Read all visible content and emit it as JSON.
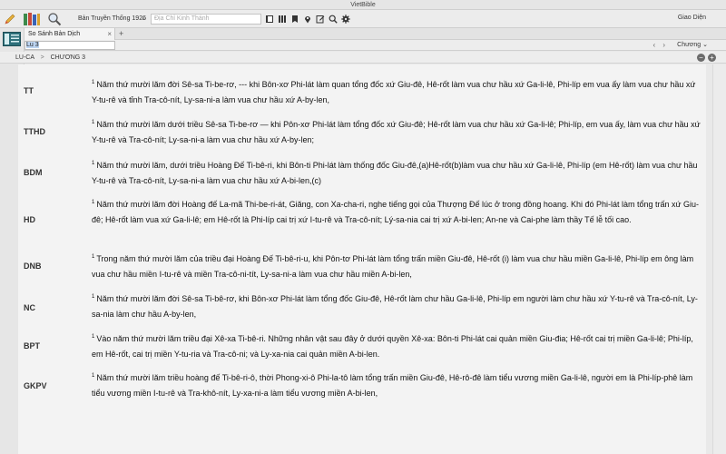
{
  "app": {
    "title": "VietBible"
  },
  "toolbar": {
    "version_select": "Bản Truyền Thống 1926",
    "search_placeholder": "Địa Chỉ Kinh Thánh",
    "theme_label": "Giao Diện"
  },
  "tabs": [
    {
      "label": "So Sánh Bản Dịch"
    }
  ],
  "reference": {
    "value": "Lu 3",
    "chapter_select": "Chương"
  },
  "breadcrumb": {
    "book": "LU-CA",
    "separator": ">",
    "chapter": "CHƯƠNG 3"
  },
  "verses": [
    {
      "abbr": "TT",
      "num": "1",
      "text": "Năm thứ mười lăm đời Sê-sa Ti-be-rơ, --- khi Bôn-xơ Phi-lát làm quan tổng đốc xứ Giu-đê, Hê-rốt làm vua chư hầu xứ Ga-li-lê, Phi-líp em vua ấy làm vua chư hầu xứ Y-tu-rê và tỉnh Tra-cô-nít, Ly-sa-ni-a làm vua chư hầu xứ A-by-len,"
    },
    {
      "abbr": "TTHD",
      "num": "1",
      "text": "Năm thứ mười lăm dưới triều Sê-sa Ti-be-rơ — khi Pôn-xơ Phi-lát làm tổng đốc xứ Giu-đê; Hê-rốt làm vua chư hầu xứ Ga-li-lê; Phi-líp, em vua ấy, làm vua chư hầu xứ Y-tu-rê và Tra-cô-nít; Ly-sa-ni-a làm vua chư hầu xứ A-by-len;"
    },
    {
      "abbr": "BDM",
      "num": "1",
      "text": "Năm thứ mười lăm, dưới triều Hoàng Đế Ti-bê-ri, khi Bôn-ti Phi-lát làm thống đốc Giu-đê,(a)Hê-rốt(b)làm vua chư hầu xứ Ga-li-lê, Phi-líp (em Hê-rốt) làm vua chư hầu Y-tu-rê và Tra-cô-nít, Ly-sa-ni-a làm vua chư hầu xứ A-bi-len,(c)"
    },
    {
      "abbr": "HD",
      "num": "1",
      "text": "Năm thứ mười lăm đời Hoàng đế La-mã Thi-be-ri-át, Giăng, con Xa-cha-ri, nghe tiếng gọi của Thượng Đế lúc ở trong đồng hoang. Khi đó Phi-lát làm tổng trấn xứ Giu-đê; Hê-rốt làm vua xứ Ga-li-lê; em Hê-rốt là Phi-líp cai trị xứ I-tu-rê và Tra-cô-nít; Lý-sa-nia cai trị xứ A-bi-len; An-ne và Cai-phe làm thầy Tế lễ tối cao."
    },
    {
      "abbr": "DNB",
      "num": "1",
      "text": "Trong năm thứ mười lăm của triều đại Hoàng Đế Ti-bê-ri-u, khi Pôn-tơ Phi-lát làm tổng trấn miền Giu-đê, Hê-rốt (i) làm vua chư hầu miền Ga-li-lê, Phi-líp em ông làm vua chư hầu miền I-tu-rê và miền Tra-cô-ni-tít, Ly-sa-ni-a làm vua chư hầu miền A-bi-len,"
    },
    {
      "abbr": "NC",
      "num": "1",
      "text": "Năm thứ mười lăm đời Sê-sa Ti-bê-rơ, khi Bôn-xơ Phi-lát làm tổng đốc Giu-đê, Hê-rốt làm chư hầu Ga-li-lê, Phi-líp em người làm chư hầu xứ Y-tu-rê và Tra-cô-nít, Ly-sa-nia làm chư hầu A-by-len,"
    },
    {
      "abbr": "BPT",
      "num": "1",
      "text": "Vào năm thứ mười lăm triều đại Xê-xa Ti-bê-ri. Những nhân vật sau đây ở dưới quyền Xê-xa: Bôn-ti Phi-lát cai quản miền Giu-đia; Hê-rốt cai trị miền Ga-li-lê; Phi-líp, em Hê-rốt, cai trị miền Y-tu-ria và Tra-cô-ni; và Ly-xa-nia cai quản miền A-bi-len."
    },
    {
      "abbr": "GKPV",
      "num": "1",
      "text": "Năm thứ mười lăm triều hoàng đế Ti-bê-ri-ô, thời Phong-xi-ô Phi-la-tô làm tổng trấn miền Giu-đê, Hê-rô-đê làm tiểu vương miền Ga-li-lê, người em là Phi-líp-phê làm tiểu vương miền I-tu-rê và Tra-khô-nít, Ly-xa-ni-a làm tiểu vương miền A-bi-len,"
    }
  ]
}
